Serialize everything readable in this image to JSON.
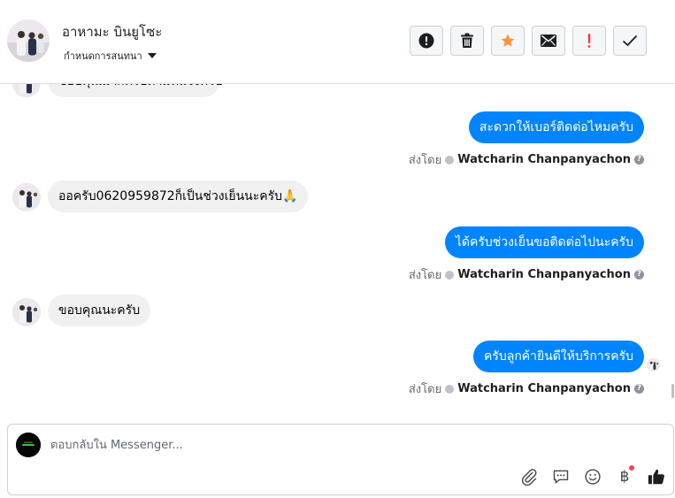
{
  "header": {
    "contact_name": "อาหามะ บินยูโซะ",
    "label_select": "กำหนดการสนทนา"
  },
  "toolbar": [
    {
      "icon": "alert-circle-icon"
    },
    {
      "icon": "trash-icon"
    },
    {
      "icon": "star-icon",
      "color": "#f7923b"
    },
    {
      "icon": "mail-icon"
    },
    {
      "icon": "exclamation-icon",
      "color": "#fa383e"
    },
    {
      "icon": "check-icon"
    }
  ],
  "messages": [
    {
      "direction": "in",
      "text": "ขอบคุณมากครับตามที่แจ้งครับ",
      "partial": true
    },
    {
      "direction": "out",
      "text": "สะดวกให้เบอร์ติดต่อไหมครับ"
    },
    {
      "direction": "in",
      "text": "ออครับ0620959872ก็เป็นช่วงเย็นนะครับ🙏"
    },
    {
      "direction": "out",
      "text": "ได้ครับช่วงเย็นขอติดต่อไปนะครับ"
    },
    {
      "direction": "in",
      "text": "ขอบคุณนะครับ"
    },
    {
      "direction": "out",
      "text": "ครับลูกค้ายินดีให้บริการครับ"
    }
  ],
  "sent_by": {
    "prefix": "ส่งโดย",
    "sender": "Watcharin Chanpanyachon",
    "help": "?"
  },
  "composer": {
    "placeholder": "ตอบกลับใน Messenger...",
    "icons": [
      "paperclip-icon",
      "saved-reply-icon",
      "emoji-icon",
      "baht-payment-icon",
      "thumbs-up-icon"
    ],
    "baht_glyph": "฿"
  },
  "colors": {
    "outgoing_bubble": "#0084ff",
    "incoming_bubble": "#f0f0f0"
  }
}
